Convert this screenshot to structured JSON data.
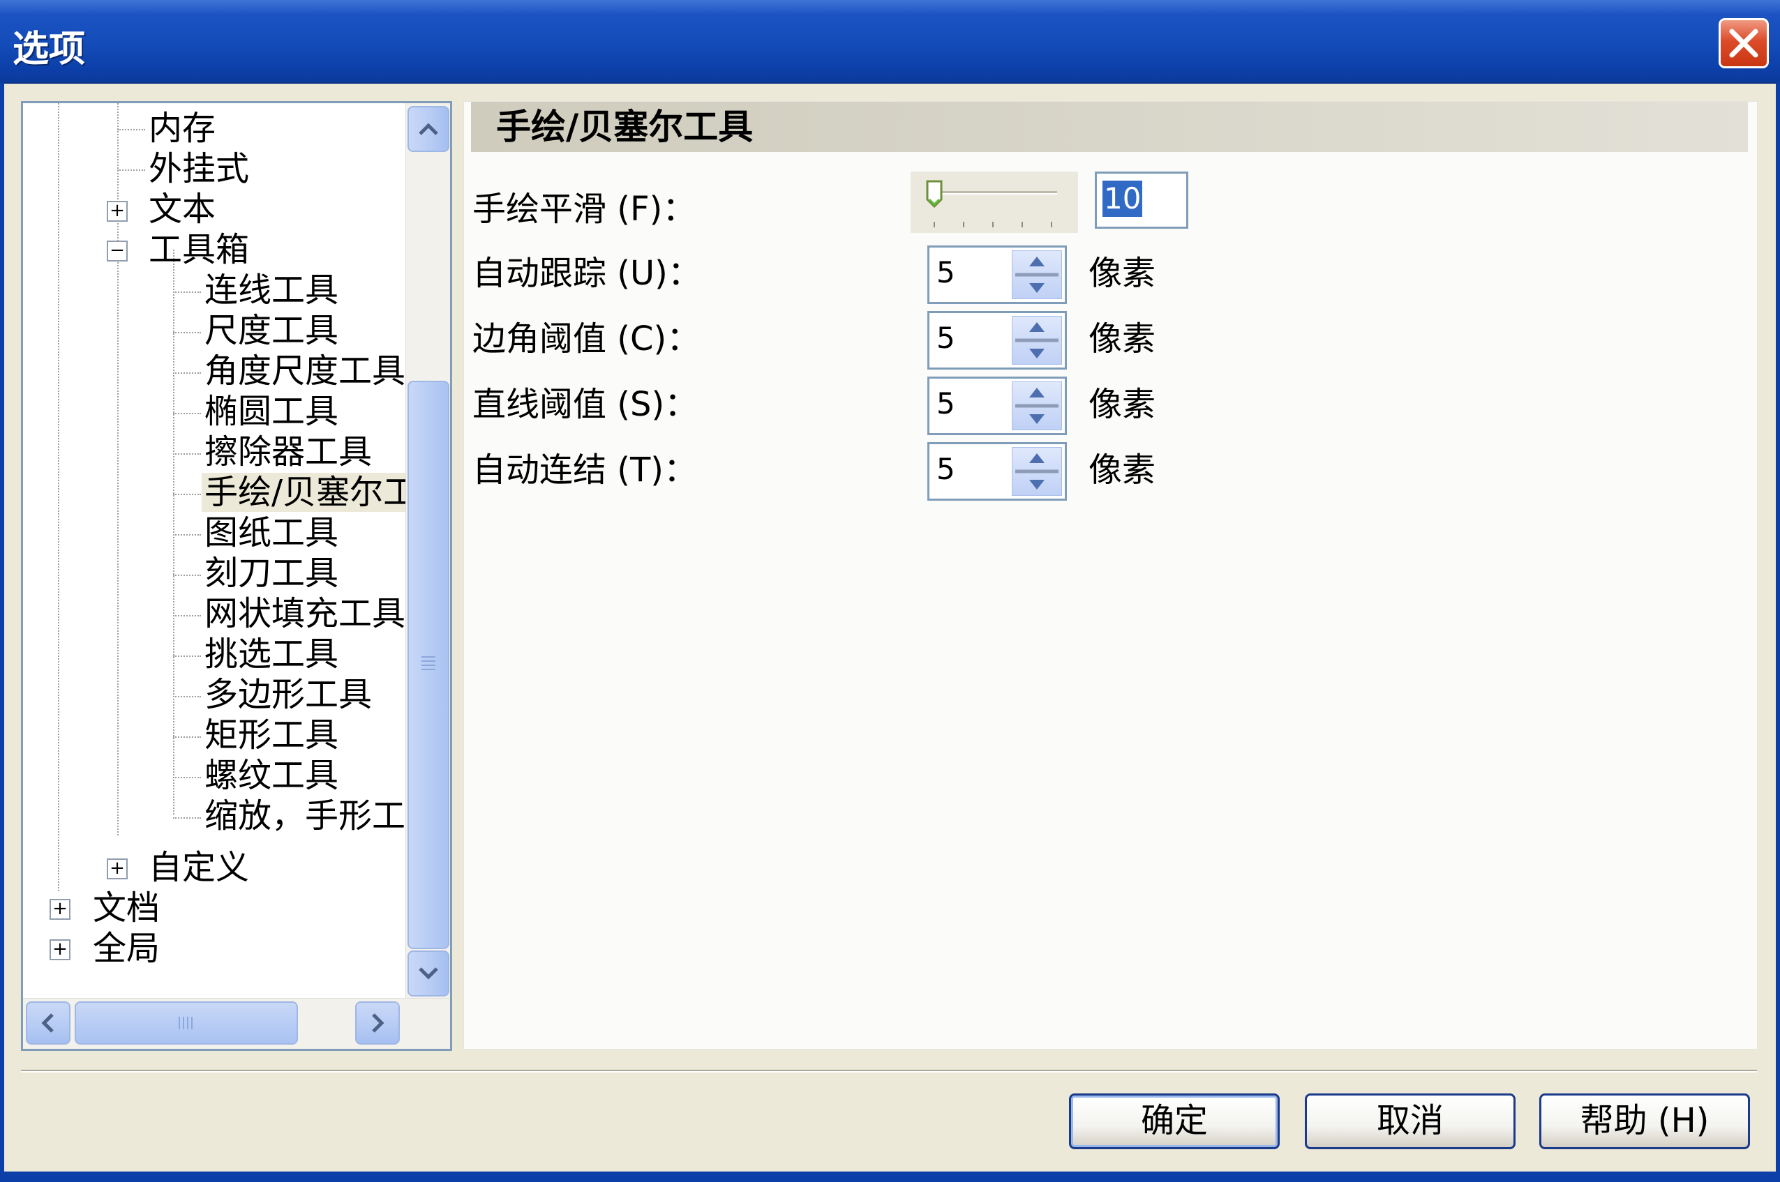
{
  "window": {
    "title": "选项"
  },
  "tree": {
    "items": [
      {
        "label": "内存"
      },
      {
        "label": "外挂式"
      },
      {
        "label": "文本"
      },
      {
        "label": "工具箱"
      },
      {
        "label": "连线工具"
      },
      {
        "label": "尺度工具"
      },
      {
        "label": "角度尺度工具"
      },
      {
        "label": "椭圆工具"
      },
      {
        "label": "擦除器工具"
      },
      {
        "label": "手绘/贝塞尔工具"
      },
      {
        "label": "图纸工具"
      },
      {
        "label": "刻刀工具"
      },
      {
        "label": "网状填充工具"
      },
      {
        "label": "挑选工具"
      },
      {
        "label": "多边形工具"
      },
      {
        "label": "矩形工具"
      },
      {
        "label": "螺纹工具"
      },
      {
        "label": "缩放，手形工具"
      },
      {
        "label": "自定义"
      },
      {
        "label": "文档"
      },
      {
        "label": "全局"
      }
    ],
    "expanders": {
      "plus": "+",
      "minus": "−"
    }
  },
  "panel": {
    "title": "手绘/贝塞尔工具",
    "smoothing": {
      "label": "手绘平滑 (F)：",
      "value": "10"
    },
    "fields": [
      {
        "label": "自动跟踪 (U)：",
        "value": "5",
        "unit": "像素"
      },
      {
        "label": "边角阈值 (C)：",
        "value": "5",
        "unit": "像素"
      },
      {
        "label": "直线阈值 (S)：",
        "value": "5",
        "unit": "像素"
      },
      {
        "label": "自动连结 (T)：",
        "value": "5",
        "unit": "像素"
      }
    ]
  },
  "buttons": {
    "ok": "确定",
    "cancel": "取消",
    "help": "帮助 (H)"
  },
  "colors": {
    "titlebar": "#134bb8",
    "close": "#dc4b29",
    "selection": "#316ac5"
  }
}
